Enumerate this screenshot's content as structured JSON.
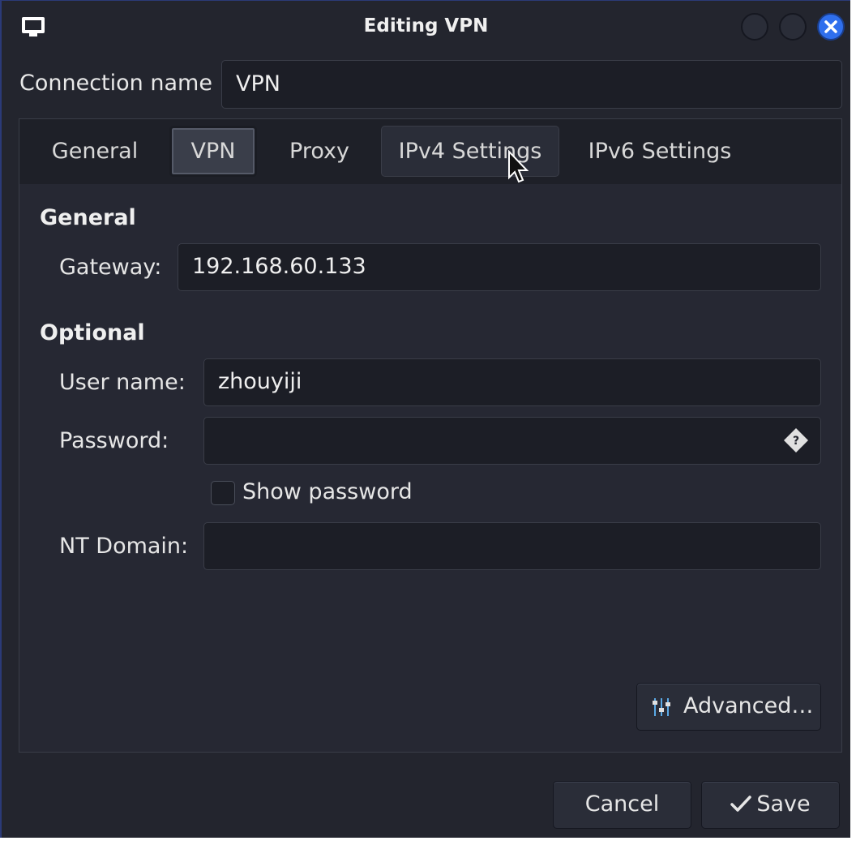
{
  "window": {
    "title": "Editing VPN",
    "accent_color": "#2f6fed"
  },
  "connection": {
    "label": "Connection name",
    "value": "VPN"
  },
  "tabs": [
    {
      "label": "General",
      "active": false
    },
    {
      "label": "VPN",
      "active": true
    },
    {
      "label": "Proxy",
      "active": false
    },
    {
      "label": "IPv4 Settings",
      "active": false,
      "hovered": true
    },
    {
      "label": "IPv6 Settings",
      "active": false
    }
  ],
  "vpn": {
    "general_section": "General",
    "gateway_label": "Gateway:",
    "gateway_value": "192.168.60.133",
    "optional_section": "Optional",
    "username_label": "User name:",
    "username_value": "zhouyiji",
    "password_label": "Password:",
    "password_value": "",
    "password_icon": "password-storage-question-icon",
    "show_password_label": "Show password",
    "show_password_checked": false,
    "ntdomain_label": "NT Domain:",
    "ntdomain_value": "",
    "advanced_label": "Advanced…",
    "advanced_icon": "settings-sliders-icon"
  },
  "buttons": {
    "cancel_label": "Cancel",
    "save_label": "Save",
    "save_icon": "checkmark-icon"
  }
}
